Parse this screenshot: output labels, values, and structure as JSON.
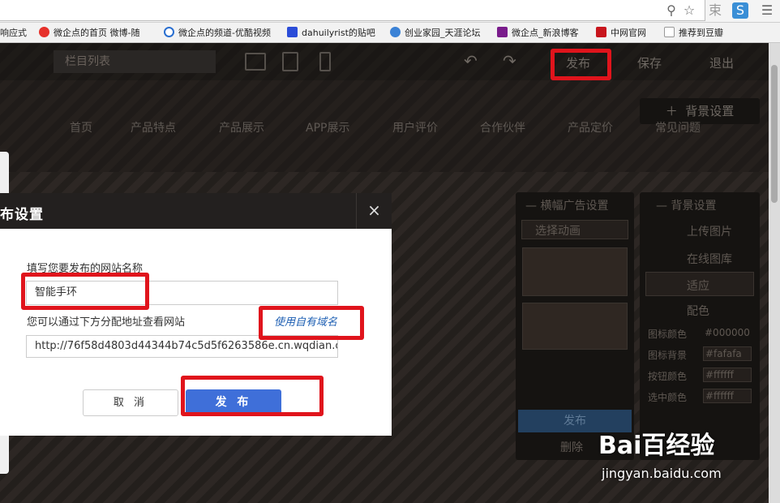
{
  "browser": {
    "toolbar_icons": [
      "zoom-icon",
      "star-icon",
      "translate-icon",
      "extension-icon",
      "menu-icon"
    ],
    "bookmarks": [
      "响应式",
      "微企点的首页 微博-随",
      "微企点的频道-优酷视频",
      "dahuilyrist的贴吧",
      "创业家园_天涯论坛",
      "微企点_新浪博客",
      "中网官网",
      "推荐到豆瓣"
    ]
  },
  "editor": {
    "column_select": "栏目列表",
    "publish": "发布",
    "save": "保存",
    "exit": "退出",
    "nav_items": [
      "首页",
      "产品特点",
      "产品展示",
      "APP展示",
      "用户评价",
      "合作伙伴",
      "产品定价",
      "常见问题"
    ],
    "bg_button": "背景设置",
    "carousel_panel": {
      "title": "横幅广告设置",
      "select": "选择动画",
      "publish": "发布",
      "delete": "删除"
    },
    "bg_panel": {
      "title": "背景设置",
      "upload": "上传图片",
      "gallery": "在线图库",
      "fit_select": "适应",
      "color_section": "配色",
      "fields": [
        {
          "label": "图标颜色",
          "value": "#000000"
        },
        {
          "label": "图标背景",
          "value": "#fafafa"
        },
        {
          "label": "按钮颜色",
          "value": "#ffffff"
        },
        {
          "label": "选中颜色",
          "value": "#ffffff"
        }
      ]
    }
  },
  "dialog": {
    "title": "布设置",
    "close": "×",
    "name_label": "填写您要发布的网站名称",
    "name_value": "智能手环",
    "url_label": "您可以通过下方分配地址查看网站",
    "own_domain_link": "使用自有域名",
    "url_value": "http://76f58d4803d44344b74c5d5f6263586e.cn.wqdian.c",
    "cancel": "取 消",
    "publish": "发 布"
  },
  "watermark": {
    "line1": "Bai百经验",
    "line2": "jingyan.baidu.com"
  },
  "colors": {
    "highlight": "#e0141c",
    "primary_button": "#3f6fd9",
    "link": "#1e5fb3"
  }
}
